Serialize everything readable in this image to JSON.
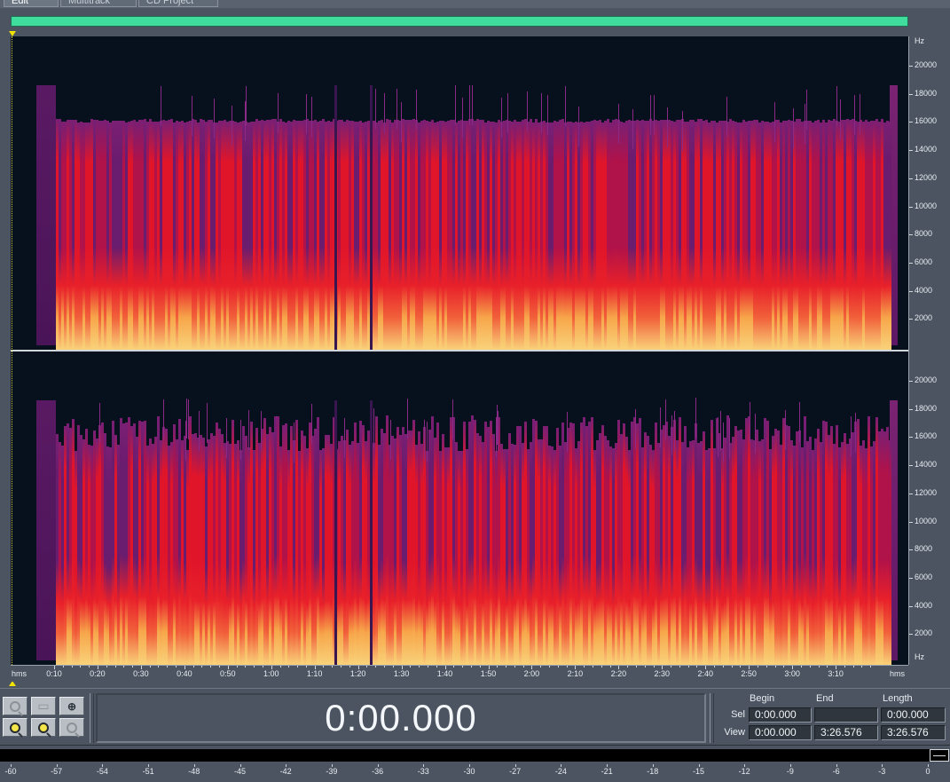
{
  "tabs": [
    {
      "label": "Edit View",
      "active": true
    },
    {
      "label": "Multitrack View",
      "active": false
    },
    {
      "label": "CD Project View",
      "active": false
    }
  ],
  "frequency_axis": {
    "unit": "Hz",
    "labels": [
      "20000",
      "18000",
      "16000",
      "14000",
      "12000",
      "10000",
      "8000",
      "6000",
      "4000",
      "2000"
    ]
  },
  "time_axis": {
    "unit": "hms",
    "labels": [
      "0:10",
      "0:20",
      "0:30",
      "0:40",
      "0:50",
      "1:00",
      "1:10",
      "1:20",
      "1:30",
      "1:40",
      "1:50",
      "2:00",
      "2:10",
      "2:20",
      "2:30",
      "2:40",
      "2:50",
      "3:00",
      "3:10"
    ]
  },
  "transport": {
    "current_time": "0:00.000"
  },
  "selection_panel": {
    "headers": {
      "begin": "Begin",
      "end": "End",
      "length": "Length"
    },
    "sel": {
      "label": "Sel",
      "begin": "0:00.000",
      "end": "",
      "length": "0:00.000"
    },
    "view": {
      "label": "View",
      "begin": "0:00.000",
      "end": "3:26.576",
      "length": "3:26.576"
    }
  },
  "level_meter": {
    "labels": [
      "-60",
      "-57",
      "-54",
      "-51",
      "-48",
      "-45",
      "-42",
      "-39",
      "-36",
      "-33",
      "-30",
      "-27",
      "-24",
      "-21",
      "-18",
      "-15",
      "-12",
      "-9",
      "-6",
      "-3",
      "0"
    ]
  },
  "zoom_buttons": [
    "zoom-out-full-icon",
    "zoom-out-icon",
    "zoom-full-icon",
    "zoom-in-vertical-icon",
    "zoom-in-icon",
    "zoom-out-vertical-icon"
  ],
  "colors": {
    "background": "#4b5460",
    "spectrogram_bg": "#07111d",
    "overview": "#3fdc9e",
    "cursor_marker": "#f2e200"
  }
}
